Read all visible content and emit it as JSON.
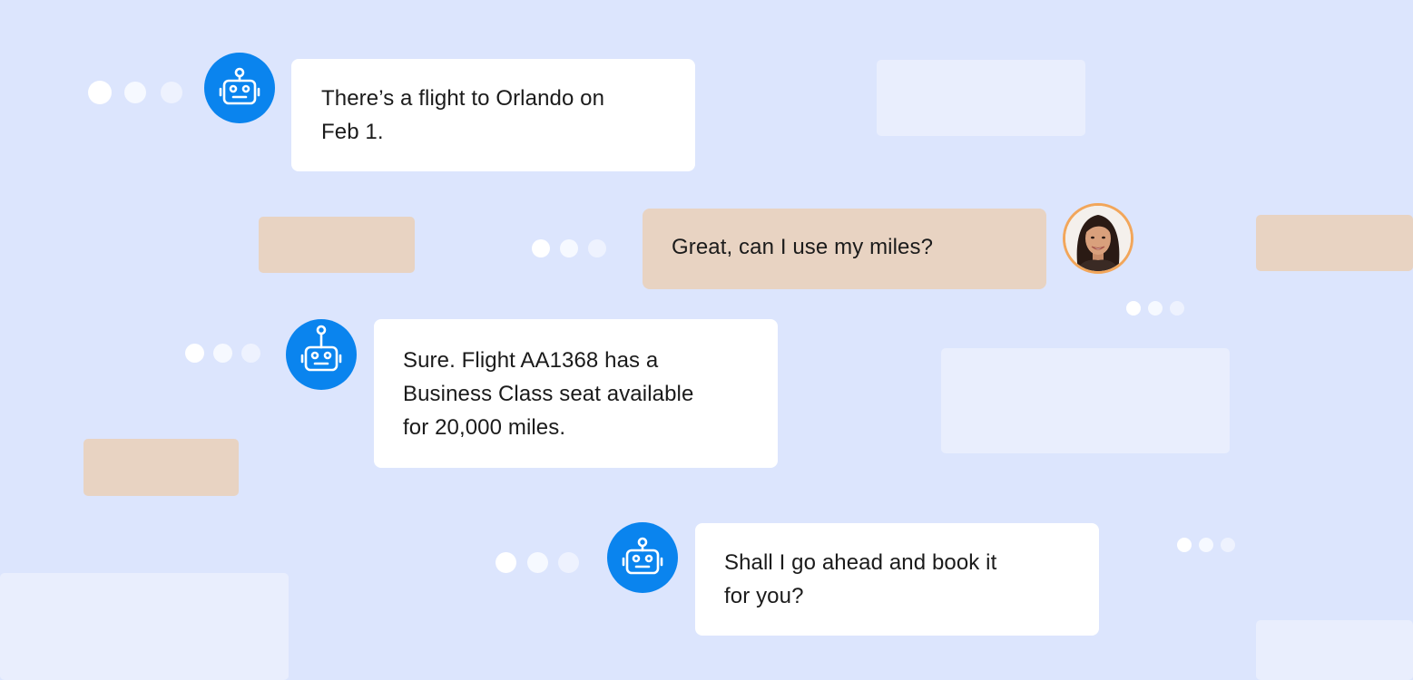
{
  "conversation": {
    "messages": [
      {
        "sender": "bot",
        "text": "There’s a flight to Orlando on\nFeb 1."
      },
      {
        "sender": "user",
        "text": "Great, can I use my miles?"
      },
      {
        "sender": "bot",
        "text": "Sure. Flight AA1368 has a\nBusiness Class seat available\nfor 20,000 miles."
      },
      {
        "sender": "bot",
        "text": "Shall I go ahead and book it\nfor you?"
      }
    ]
  },
  "icons": {
    "bot_avatar": "robot-icon",
    "user_avatar": "user-avatar-photo",
    "typing_indicator": "typing-dots-icon"
  },
  "colors": {
    "background": "#dce5fd",
    "bot_bubble": "#ffffff",
    "user_bubble": "#e8d3c2",
    "bot_avatar": "#0a84ee",
    "user_avatar_ring": "#f2a65a",
    "placeholder_light": "#e9eefd",
    "placeholder_tan": "#e8d3c2"
  }
}
